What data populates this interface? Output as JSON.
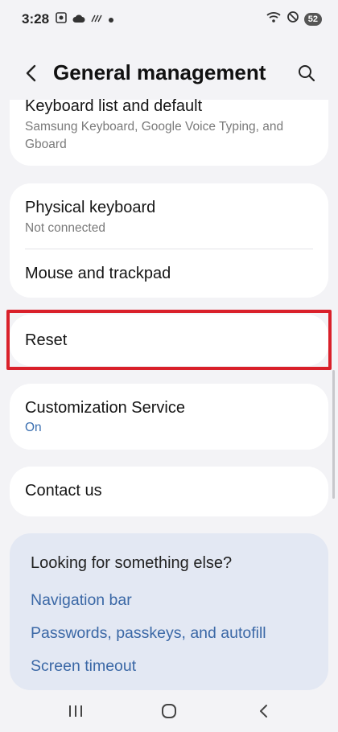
{
  "status_bar": {
    "time": "3:28",
    "battery": "52",
    "left_icons": [
      "screenshot-icon",
      "cloud-icon",
      "signal-lines-icon",
      "dot-icon"
    ],
    "right_icons": [
      "wifi-icon",
      "do-not-disturb-icon",
      "battery-icon"
    ]
  },
  "header": {
    "title": "General management",
    "back_icon": "back-chevron-icon",
    "search_icon": "search-icon"
  },
  "cards": {
    "keyboard_list": {
      "title": "Keyboard list and default",
      "subtitle": "Samsung Keyboard, Google Voice Typing, and Gboard"
    },
    "physical_keyboard": {
      "title": "Physical keyboard",
      "subtitle": "Not connected"
    },
    "mouse_trackpad": {
      "title": "Mouse and trackpad"
    },
    "reset": {
      "title": "Reset"
    },
    "customization": {
      "title": "Customization Service",
      "subtitle": "On"
    },
    "contact": {
      "title": "Contact us"
    }
  },
  "suggestions": {
    "title": "Looking for something else?",
    "links": [
      "Navigation bar",
      "Passwords, passkeys, and autofill",
      "Screen timeout"
    ]
  },
  "colors": {
    "highlight": "#d9202a",
    "link": "#3b68a6",
    "status_on": "#3a6fb0"
  },
  "nav_bar": {
    "icons": [
      "recent-apps-icon",
      "home-icon",
      "back-icon"
    ]
  }
}
